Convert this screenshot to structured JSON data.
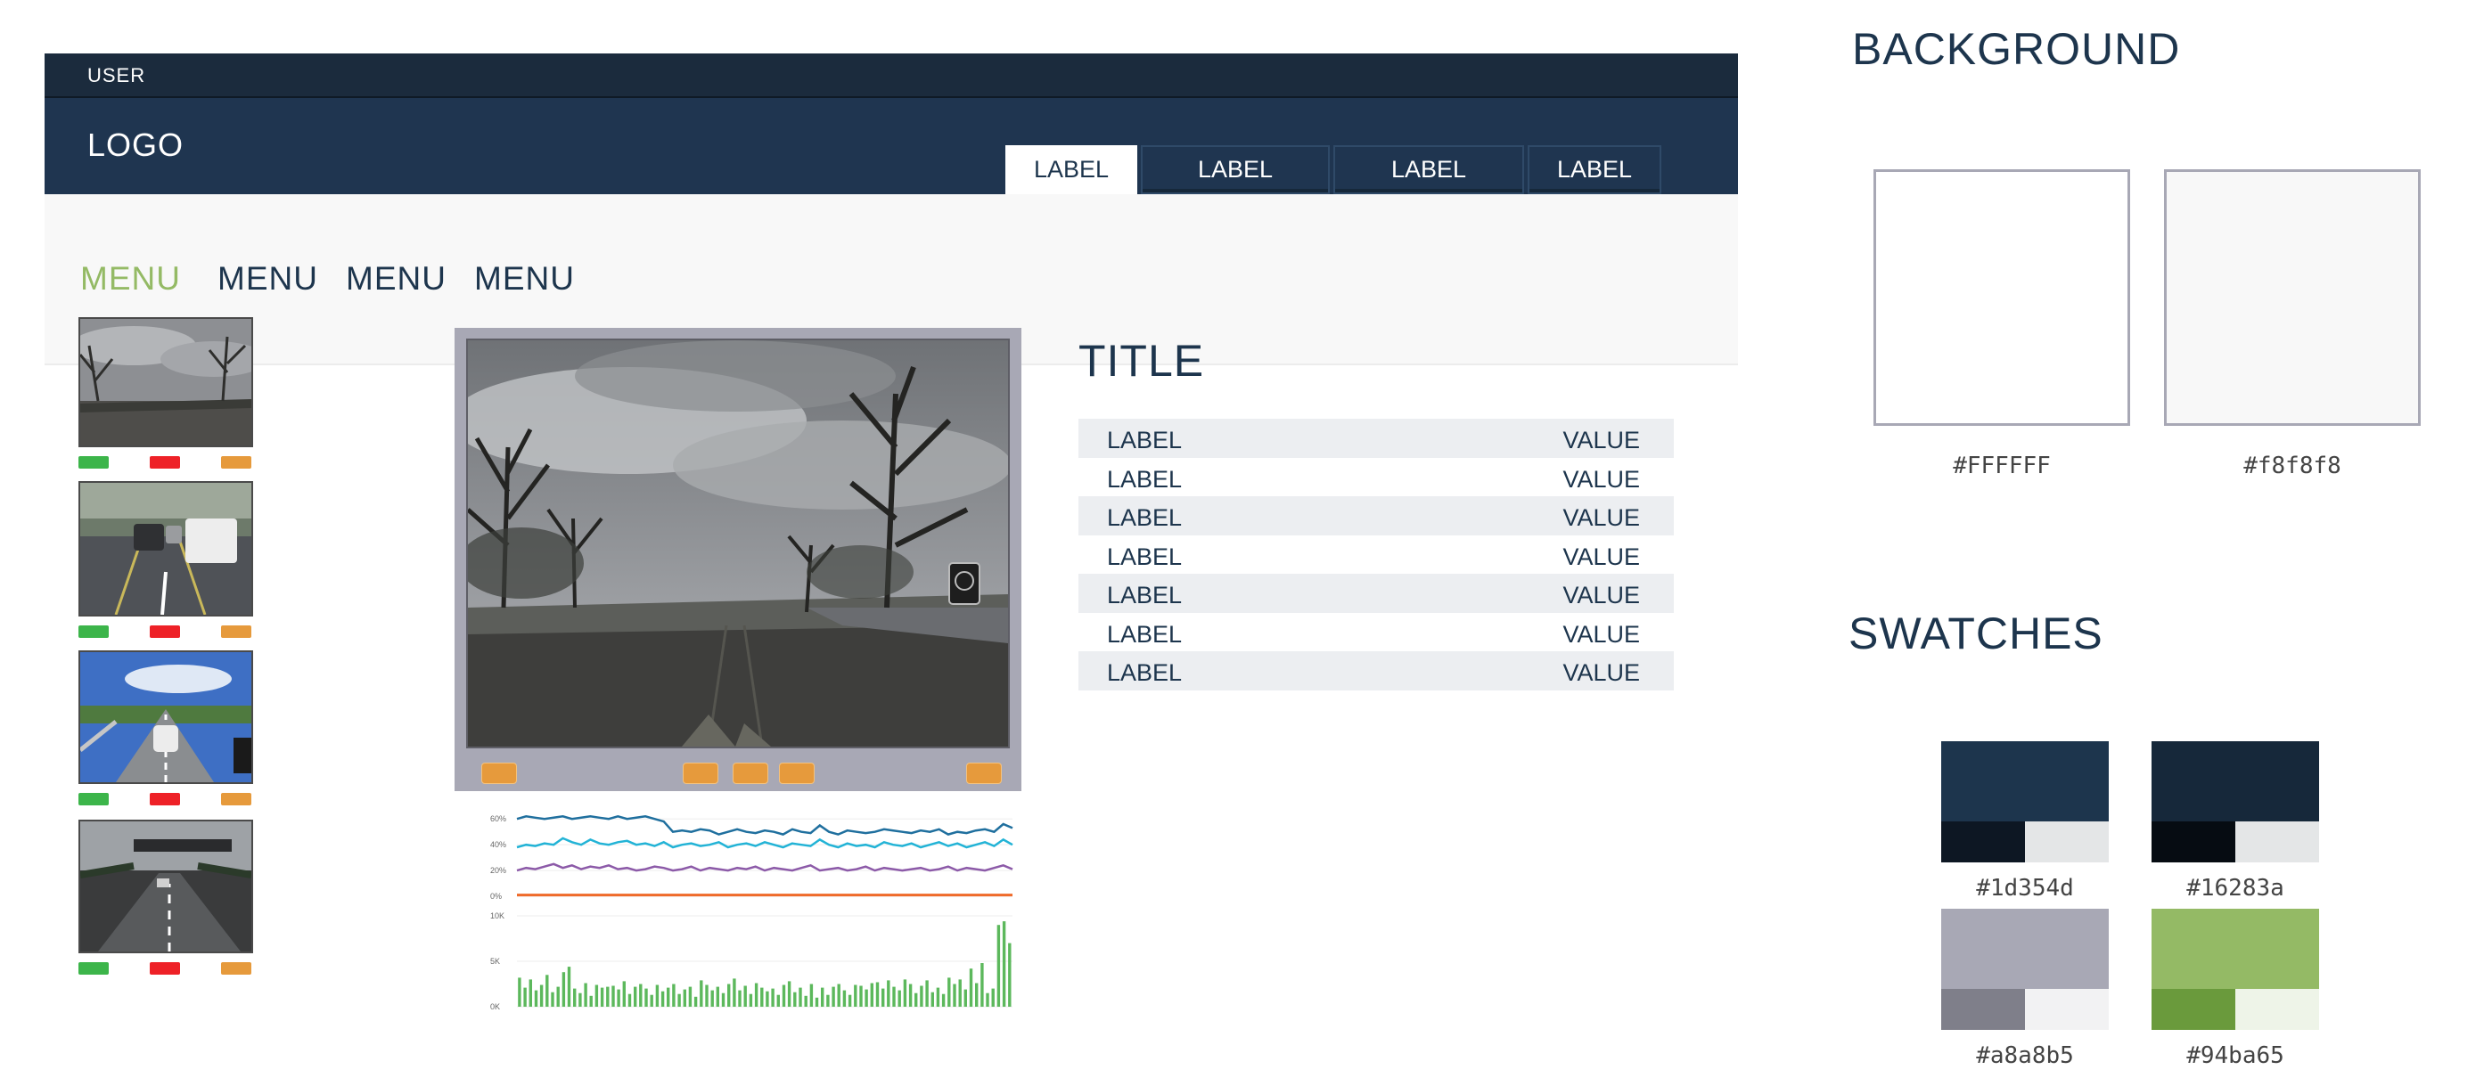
{
  "header": {
    "user_label": "USER",
    "logo": "LOGO",
    "tabs": [
      {
        "label": "LABEL",
        "active": true
      },
      {
        "label": "LABEL",
        "active": false
      },
      {
        "label": "LABEL",
        "active": false
      },
      {
        "label": "LABEL",
        "active": false
      }
    ]
  },
  "menu": [
    {
      "label": "MENU",
      "active": true
    },
    {
      "label": "MENU",
      "active": false
    },
    {
      "label": "MENU",
      "active": false
    },
    {
      "label": "MENU",
      "active": false
    }
  ],
  "thumbnails": [
    {
      "scene": "cloudy-road-trees"
    },
    {
      "scene": "city-traffic-van"
    },
    {
      "scene": "highway-blue-sky"
    },
    {
      "scene": "motorway-overpass"
    }
  ],
  "indicator_colors": [
    "#3cb54a",
    "#ee2127",
    "#e69a3c"
  ],
  "player": {
    "controls": [
      "rewind",
      "previous",
      "play",
      "next",
      "fullscreen"
    ]
  },
  "chart_data": [
    {
      "type": "line",
      "yticks": [
        "60%",
        "40%",
        "20%",
        "0%"
      ],
      "ylim": [
        0,
        65
      ],
      "series": [
        {
          "color": "#1f6f9e",
          "values": [
            60,
            62,
            61,
            60,
            61,
            62,
            60,
            61,
            62,
            61,
            60,
            62,
            60,
            61,
            62,
            60,
            58,
            50,
            51,
            50,
            52,
            51,
            48,
            50,
            52,
            50,
            49,
            51,
            50,
            48,
            52,
            50,
            49,
            55,
            50,
            48,
            51,
            50,
            49,
            50,
            52,
            51,
            50,
            49,
            51,
            50,
            52,
            48,
            50,
            49,
            51,
            52,
            50,
            56,
            53
          ]
        },
        {
          "color": "#22b3d6",
          "values": [
            38,
            40,
            39,
            41,
            40,
            45,
            42,
            40,
            44,
            41,
            40,
            42,
            43,
            40,
            41,
            39,
            42,
            38,
            40,
            41,
            39,
            40,
            42,
            38,
            40,
            41,
            39,
            42,
            40,
            38,
            41,
            40,
            39,
            44,
            40,
            38,
            41,
            39,
            40,
            38,
            42,
            40,
            39,
            41,
            38,
            40,
            42,
            39,
            41,
            38,
            40,
            42,
            39,
            44,
            40
          ]
        },
        {
          "color": "#8c5aa8",
          "values": [
            20,
            22,
            21,
            23,
            25,
            22,
            24,
            21,
            23,
            22,
            24,
            21,
            22,
            20,
            21,
            23,
            22,
            20,
            21,
            23,
            20,
            22,
            21,
            20,
            22,
            21,
            23,
            20,
            22,
            21,
            20,
            22,
            24,
            20,
            21,
            22,
            20,
            21,
            23,
            20,
            22,
            21,
            20,
            21,
            22,
            20,
            21,
            23,
            20,
            22,
            21,
            20,
            22,
            24,
            21
          ]
        },
        {
          "color": "#ef6a2a",
          "values": [
            1,
            1,
            1,
            1,
            1,
            1,
            1,
            1,
            1,
            1,
            1,
            1,
            1,
            1,
            1,
            1,
            1,
            1,
            1,
            1,
            1,
            1,
            1,
            1,
            1,
            1,
            1,
            1,
            1,
            1,
            1,
            1,
            1,
            1,
            1,
            1,
            1,
            1,
            1,
            1,
            1,
            1,
            1,
            1,
            1,
            1,
            1,
            1,
            1,
            1,
            1,
            1,
            1,
            1,
            1
          ]
        }
      ]
    },
    {
      "type": "bar",
      "yticks": [
        "10K",
        "5K",
        "0K"
      ],
      "ylim": [
        0,
        10
      ],
      "color": "#5cb85c",
      "values": [
        3.2,
        2.1,
        3.0,
        1.8,
        2.4,
        3.5,
        1.6,
        2.2,
        3.8,
        4.4,
        2.0,
        1.5,
        2.6,
        1.2,
        2.4,
        2.1,
        2.2,
        2.3,
        1.9,
        2.8,
        1.4,
        2.2,
        2.5,
        2.0,
        1.3,
        2.4,
        1.7,
        2.1,
        2.5,
        1.4,
        1.9,
        2.2,
        1.1,
        2.9,
        2.4,
        1.8,
        2.2,
        1.5,
        2.5,
        3.1,
        1.8,
        2.3,
        1.4,
        2.6,
        2.1,
        1.7,
        2.0,
        1.3,
        2.4,
        2.8,
        1.6,
        2.1,
        1.2,
        2.5,
        1.0,
        2.1,
        1.3,
        2.2,
        2.5,
        1.8,
        1.3,
        2.4,
        2.3,
        1.9,
        2.6,
        2.7,
        2.0,
        2.9,
        2.2,
        1.8,
        3.0,
        2.5,
        1.5,
        2.3,
        2.9,
        1.6,
        2.1,
        1.4,
        3.2,
        2.5,
        3.0,
        1.9,
        4.2,
        2.6,
        4.8,
        1.5,
        2.0,
        9.0,
        9.4,
        7.0
      ]
    }
  ],
  "info": {
    "title": "TITLE",
    "rows": [
      {
        "label": "LABEL",
        "value": "VALUE"
      },
      {
        "label": "LABEL",
        "value": "VALUE"
      },
      {
        "label": "LABEL",
        "value": "VALUE"
      },
      {
        "label": "LABEL",
        "value": "VALUE"
      },
      {
        "label": "LABEL",
        "value": "VALUE"
      },
      {
        "label": "LABEL",
        "value": "VALUE"
      },
      {
        "label": "LABEL",
        "value": "VALUE"
      }
    ]
  },
  "style_guide": {
    "background_heading": "BACKGROUND",
    "backgrounds": [
      {
        "hex": "#FFFFFF",
        "color": "#FFFFFF"
      },
      {
        "hex": "#f8f8f8",
        "color": "#f8f8f8"
      }
    ],
    "swatches_heading": "SWATCHES",
    "swatches": [
      {
        "hex": "#1d354d",
        "main": "#1d354d",
        "dark": "#0d1723",
        "light": "#e4e6e7"
      },
      {
        "hex": "#16283a",
        "main": "#16283a",
        "dark": "#060c12",
        "light": "#e4e6e7"
      },
      {
        "hex": "#a8a8b5",
        "main": "#a8a8b5",
        "dark": "#7f7f8a",
        "light": "#f2f2f3"
      },
      {
        "hex": "#94ba65",
        "main": "#94ba65",
        "dark": "#6a9a3c",
        "light": "#eef4e8"
      }
    ]
  }
}
